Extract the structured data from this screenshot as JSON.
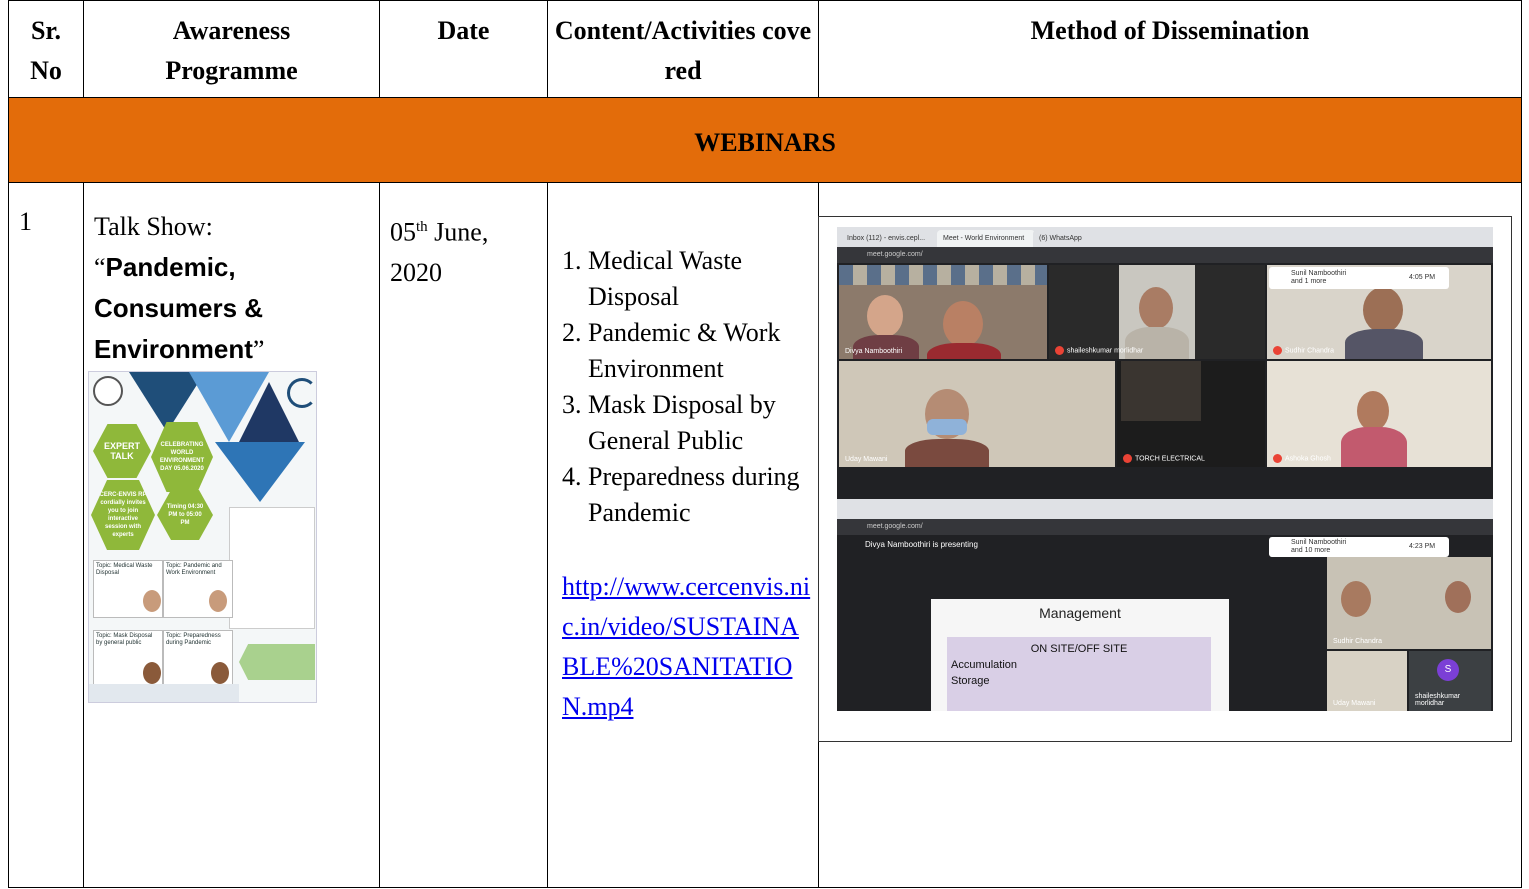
{
  "headers": {
    "sr": "Sr. No",
    "programme": "Awareness Programme",
    "date": "Date",
    "content": "Content/Activities covered",
    "method": "Method of Dissemination"
  },
  "section_title": "WEBINARS",
  "row": {
    "sr": "1",
    "programme_prefix": "Talk Show:",
    "programme_title_open": "“",
    "programme_title": "Pandemic, Consumers & Environment",
    "programme_title_close": "”",
    "date_day": "05",
    "date_sup": "th",
    "date_rest": " June, 2020",
    "content_items": [
      "1.        Medical Waste Disposal",
      "2.        Pandemic & Work Environment",
      "3. Mask Disposal by General Public",
      "4. Preparedness during Pandemic"
    ],
    "link": "http://www.cercenvis.nic.in/video/SUSTAINABLE%20SANITATION.mp4"
  },
  "poster": {
    "expert": "EXPERT TALK",
    "celebrating": "CELEBRATING WORLD ENVIRONMENT DAY 05.06.2020",
    "invite": "CERC-ENVIS RP cordially invites you to join interactive session with experts",
    "timing": "Timing 04:30 PM to 05:00 PM",
    "topic1": "Topic: Medical Waste Disposal",
    "topic2": "Topic: Pandemic and Work Environment",
    "topic3": "Topic: Mask Disposal by general public",
    "topic4": "Topic: Preparedness during Pandemic"
  },
  "screenshot": {
    "tab1": "Inbox (112) - envis.cepl...",
    "tab2": "Meet - World Environment",
    "tab3": "(6) WhatsApp",
    "url": "meet.google.com/",
    "time1": "4:05 PM",
    "time2": "4:23 PM",
    "presenting": "Divya Namboothiri is presenting",
    "p_divya": "Divya Namboothiri",
    "p_shailesh": "shaileshkumar morlidhar",
    "p_sudhir": "Sudhir Chandra",
    "p_uday": "Uday Mawani",
    "p_torch": "TORCH ELECTRICAL",
    "p_ashoka": "Ashoka Ghosh",
    "p_sunil": "Sunil Namboothiri and 1 more",
    "p_sunil2": "Sunil Namboothiri and 10 more",
    "slide_title": "Management",
    "slide_sub": "ON SITE/OFF SITE",
    "slide_l1": "Accumulation",
    "slide_l2": "Storage"
  },
  "colors": {
    "band": "#e36c0a",
    "link": "#0000ee",
    "poster_green": "#8fb83a",
    "poster_blue": "#1f4e79"
  }
}
